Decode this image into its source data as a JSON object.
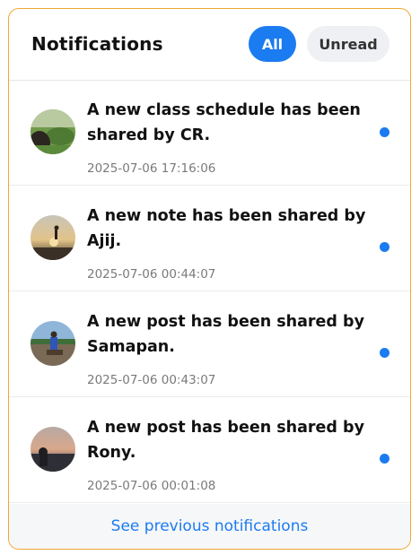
{
  "header": {
    "title": "Notifications",
    "tabs": [
      {
        "label": "All",
        "active": true
      },
      {
        "label": "Unread",
        "active": false
      }
    ]
  },
  "notifications": [
    {
      "message": "A new class schedule has been shared by CR.",
      "time": "2025-07-06 17:16:06",
      "unread": true,
      "avatar": "avatar-photo"
    },
    {
      "message": "A new note has been shared by Ajij.",
      "time": "2025-07-06 00:44:07",
      "unread": true,
      "avatar": "avatar-photo"
    },
    {
      "message": "A new post has been shared by Samapan.",
      "time": "2025-07-06 00:43:07",
      "unread": true,
      "avatar": "avatar-photo"
    },
    {
      "message": "A new post has been shared by Rony.",
      "time": "2025-07-06 00:01:08",
      "unread": true,
      "avatar": "avatar-photo"
    }
  ],
  "footer": {
    "link_label": "See previous notifications"
  },
  "colors": {
    "accent": "#1b7bf0",
    "panel_border": "#f0a830",
    "unread_dot": "#1b7bf0"
  }
}
